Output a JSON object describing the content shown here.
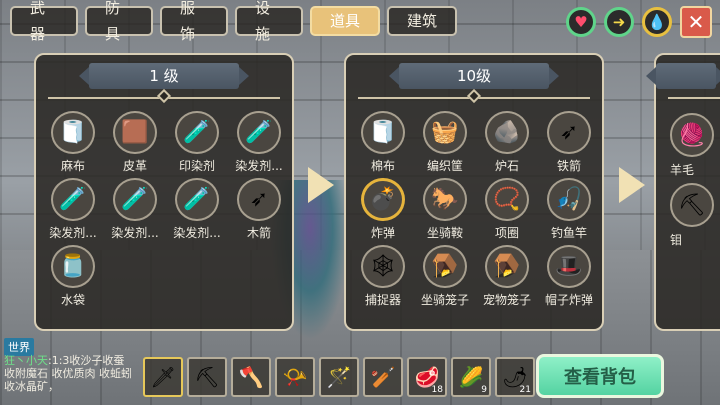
{
  "tabs": [
    "武器",
    "防具",
    "服饰",
    "设施",
    "道具",
    "建筑"
  ],
  "active_tab": "道具",
  "top_buttons": [
    "heart-icon",
    "arrow-icon",
    "drop-icon"
  ],
  "panels": [
    {
      "title": "1 级",
      "items": [
        {
          "label": "麻布",
          "icon": "cloth-icon"
        },
        {
          "label": "皮革",
          "icon": "leather-icon"
        },
        {
          "label": "印染剂",
          "icon": "potion-icon"
        },
        {
          "label": "染发剂...",
          "icon": "potion-icon"
        },
        {
          "label": "染发剂...",
          "icon": "potion-icon"
        },
        {
          "label": "染发剂...",
          "icon": "potion-icon"
        },
        {
          "label": "染发剂...",
          "icon": "potion-icon"
        },
        {
          "label": "木箭",
          "icon": "arrow-icon"
        },
        {
          "label": "水袋",
          "icon": "waterbag-icon"
        }
      ]
    },
    {
      "title": "10级",
      "items": [
        {
          "label": "棉布",
          "icon": "cloth-icon"
        },
        {
          "label": "编织筐",
          "icon": "basket-icon"
        },
        {
          "label": "炉石",
          "icon": "stone-icon"
        },
        {
          "label": "铁箭",
          "icon": "arrow-icon"
        },
        {
          "label": "炸弹",
          "icon": "bomb-icon"
        },
        {
          "label": "坐骑鞍",
          "icon": "saddle-icon"
        },
        {
          "label": "项圈",
          "icon": "collar-icon"
        },
        {
          "label": "钓鱼竿",
          "icon": "rod-icon"
        },
        {
          "label": "捕捉器",
          "icon": "trap-icon"
        },
        {
          "label": "坐骑笼子",
          "icon": "cage-icon"
        },
        {
          "label": "宠物笼子",
          "icon": "cage-icon"
        },
        {
          "label": "帽子炸弹",
          "icon": "hat-bomb-icon"
        }
      ]
    },
    {
      "title": "",
      "items": [
        {
          "label": "羊毛",
          "icon": "wool-icon"
        },
        {
          "label": "钼",
          "icon": "ore-icon"
        }
      ]
    }
  ],
  "chat": {
    "channel": "世界",
    "name": "狂丶小天",
    "message": ":1:3收沙子收蚕 收附魔石 收优质肉 收蚯蚓 收冰晶矿，"
  },
  "hotbar": [
    {
      "icon": "sword-icon",
      "count": ""
    },
    {
      "icon": "pickaxe-icon",
      "count": ""
    },
    {
      "icon": "axe-icon",
      "count": ""
    },
    {
      "icon": "horn-icon",
      "count": ""
    },
    {
      "icon": "staff-icon",
      "count": ""
    },
    {
      "icon": "club-icon",
      "count": ""
    },
    {
      "icon": "meat-icon",
      "count": "18"
    },
    {
      "icon": "corn-icon",
      "count": "9"
    },
    {
      "icon": "pepper-icon",
      "count": "21"
    }
  ],
  "bag_button": "查看背包",
  "colors": {
    "active_tab": "#e8c27a",
    "bag_button": "#54d3a2",
    "close_button": "#d95a4a",
    "ring_green": "#5fd48a"
  }
}
